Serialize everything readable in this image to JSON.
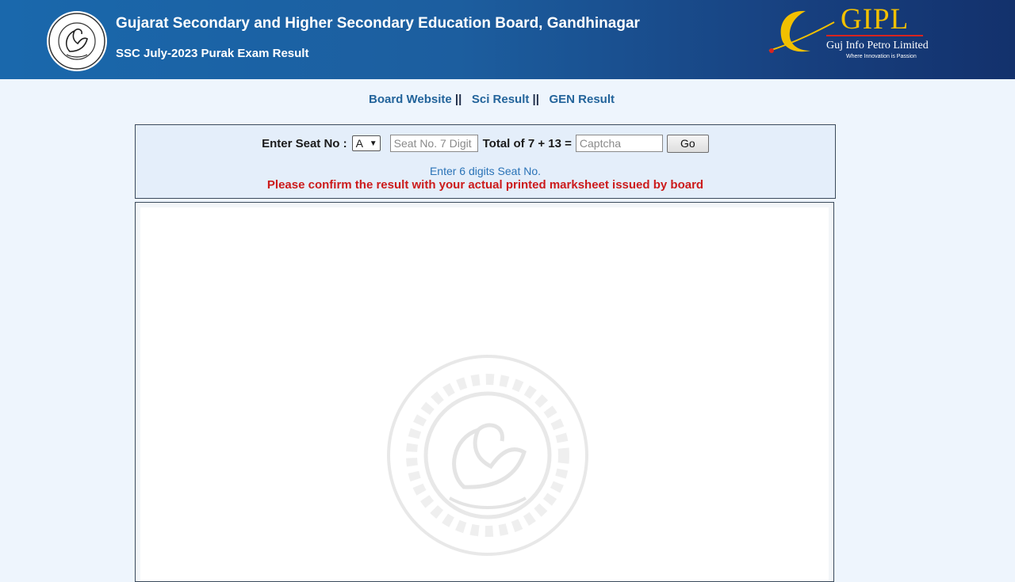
{
  "header": {
    "title": "Gujarat Secondary and Higher Secondary Education Board, Gandhinagar",
    "subtitle": "SSC July-2023 Purak Exam Result",
    "board_logo_icon": "board-seal-icon",
    "partner_logo": {
      "brand": "GIPL",
      "name": "Guj Info Petro Limited",
      "tagline": "Where Innovation is Passion",
      "brand_color": "#f2c000",
      "accent_color": "#d8241f"
    }
  },
  "nav": {
    "links": [
      {
        "label": "Board Website",
        "sep": "||"
      },
      {
        "label": "Sci Result",
        "sep": "||"
      },
      {
        "label": "GEN Result",
        "sep": ""
      }
    ]
  },
  "form": {
    "seat_label": "Enter Seat No :",
    "seat_prefix_selected": "A",
    "seat_placeholder": "Seat No. 7 Digit",
    "captcha_question": "Total of 7 + 13 =",
    "captcha_placeholder": "Captcha",
    "go_label": "Go",
    "hint": "Enter 6 digits Seat No.",
    "warning": "Please confirm the result with your actual printed marksheet issued by board"
  },
  "colors": {
    "header_bg": "#1a68ac",
    "link": "#23649b",
    "hint": "#2a73b7",
    "warning": "#cc1b1b",
    "page_bg": "#eef5fd"
  }
}
